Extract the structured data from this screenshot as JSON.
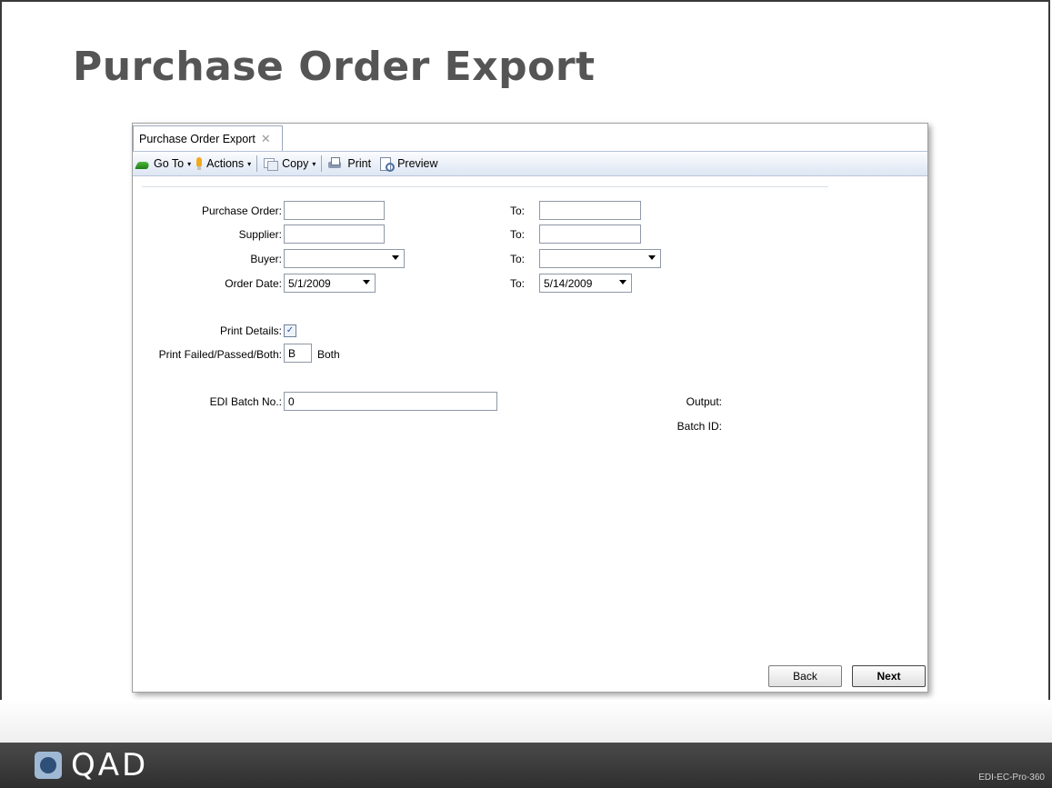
{
  "slide": {
    "title": "Purchase Order Export",
    "footer_code": "EDI-EC-Pro-360",
    "logo_text": "QAD"
  },
  "tab": {
    "label": "Purchase Order Export",
    "close_glyph": "✕"
  },
  "toolbar": {
    "goto_label": "Go To",
    "actions_label": "Actions",
    "copy_label": "Copy",
    "print_label": "Print",
    "preview_label": "Preview",
    "caret": "▾"
  },
  "form": {
    "purchase_order": {
      "label": "Purchase Order:",
      "value": "",
      "to_label": "To:",
      "to_value": ""
    },
    "supplier": {
      "label": "Supplier:",
      "value": "",
      "to_label": "To:",
      "to_value": ""
    },
    "buyer": {
      "label": "Buyer:",
      "value": "",
      "to_label": "To:",
      "to_value": ""
    },
    "order_date": {
      "label": "Order Date:",
      "value": "5/1/2009",
      "to_label": "To:",
      "to_value": "5/14/2009"
    },
    "print_details": {
      "label": "Print Details:",
      "checked": true,
      "check_glyph": "✓"
    },
    "print_failed": {
      "label": "Print Failed/Passed/Both:",
      "value": "B",
      "description": "Both"
    },
    "edi_batch": {
      "label": "EDI Batch No.:",
      "value": "0"
    },
    "output_label": "Output:",
    "batch_id_label": "Batch ID:"
  },
  "buttons": {
    "back": "Back",
    "next": "Next"
  }
}
